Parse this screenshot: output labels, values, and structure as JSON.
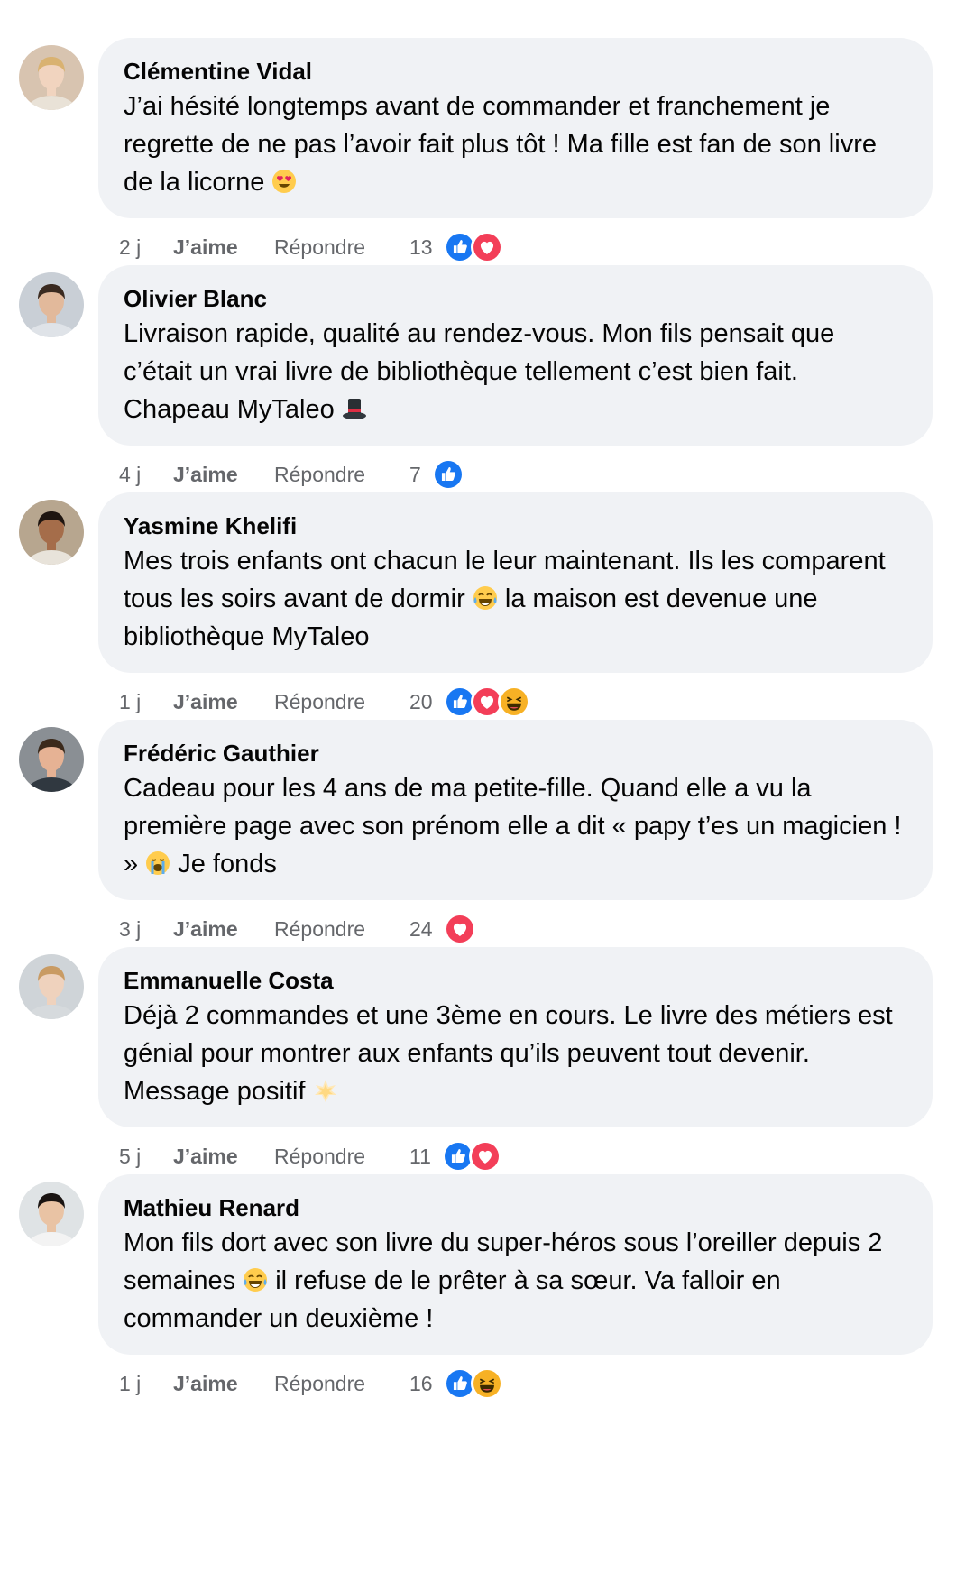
{
  "comments": [
    {
      "author": "Clémentine Vidal",
      "text_before": "J’ai hésité longtemps avant de commander et franchement je regrette de ne pas l’avoir fait plus tôt ! Ma fille est fan de son livre de la licorne ",
      "emoji": "heart-eyes-emoji",
      "text_after": "",
      "time": "2 j",
      "like_label": "J’aime",
      "reply_label": "Répondre",
      "count": "13",
      "reactions": [
        "like",
        "love"
      ]
    },
    {
      "author": "Olivier Blanc",
      "text_before": "Livraison rapide, qualité au rendez-vous. Mon fils pensait que c’était un vrai livre de bibliothèque tellement c’est bien fait. Chapeau MyTaleo ",
      "emoji": "top-hat-emoji",
      "text_after": "",
      "time": "4 j",
      "like_label": "J’aime",
      "reply_label": "Répondre",
      "count": "7",
      "reactions": [
        "like"
      ]
    },
    {
      "author": "Yasmine Khelifi",
      "text_before": "Mes trois enfants ont chacun le leur maintenant. Ils les comparent tous les soirs avant de dormir ",
      "emoji": "tears-of-joy-emoji",
      "text_after": " la maison est devenue une bibliothèque MyTaleo",
      "time": "1 j",
      "like_label": "J’aime",
      "reply_label": "Répondre",
      "count": "20",
      "reactions": [
        "like",
        "love",
        "haha"
      ]
    },
    {
      "author": "Frédéric Gauthier",
      "text_before": "Cadeau pour les 4 ans de ma petite-fille. Quand elle a vu la première page avec son prénom elle a dit « papy t’es un magicien ! » ",
      "emoji": "crying-emoji",
      "text_after": " Je fonds",
      "time": "3 j",
      "like_label": "J’aime",
      "reply_label": "Répondre",
      "count": "24",
      "reactions": [
        "love"
      ]
    },
    {
      "author": "Emmanuelle Costa",
      "text_before": "Déjà 2 commandes et une 3ème en cours. Le livre des métiers est génial pour montrer aux enfants qu’ils peuvent tout devenir. Message positif ",
      "emoji": "star-emoji",
      "text_after": "",
      "time": "5 j",
      "like_label": "J’aime",
      "reply_label": "Répondre",
      "count": "11",
      "reactions": [
        "like",
        "love"
      ]
    },
    {
      "author": "Mathieu Renard",
      "text_before": "Mon fils dort avec son livre du super-héros sous l’oreiller depuis 2 semaines ",
      "emoji": "tears-of-joy-emoji",
      "text_after": " il refuse de le prêter à sa sœur. Va falloir en commander un deuxième !",
      "time": "1 j",
      "like_label": "J’aime",
      "reply_label": "Répondre",
      "count": "16",
      "reactions": [
        "like",
        "haha"
      ]
    }
  ],
  "colors": {
    "bubble": "#f0f2f5",
    "text": "#050505",
    "meta": "#65676b",
    "like_blue": "#1877f2",
    "love_red": "#f33e58",
    "haha_yellow": "#f7b125"
  }
}
